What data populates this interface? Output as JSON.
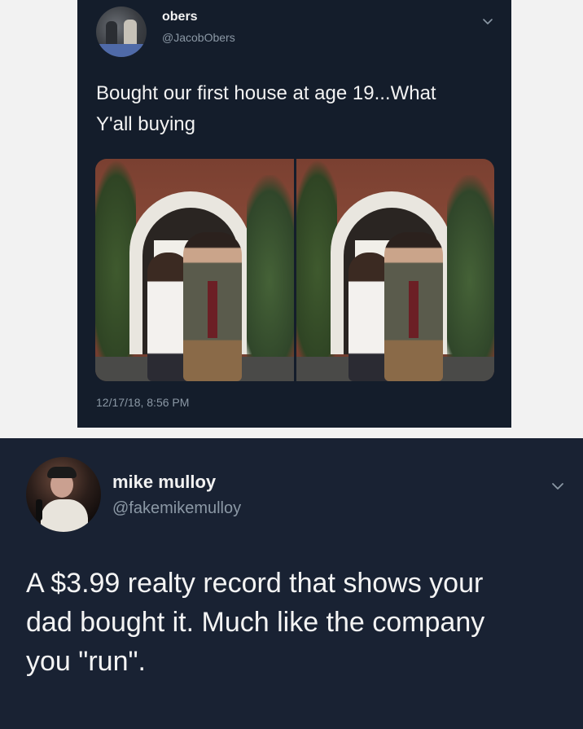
{
  "tweet_top": {
    "name": "obers",
    "handle": "@JacobObers",
    "text_line1": "Bought our first house at age 19...What",
    "text_line2": "Y'all buying",
    "date": "12/17/18, 8:56 PM",
    "chevron_icon": "chevron-down-icon"
  },
  "tweet_reply": {
    "name": "mike mulloy",
    "handle": "@fakemikemulloy",
    "text_line1": "A $3.99 realty record that shows your",
    "text_line2": "dad bought it. Much like the company",
    "text_line3": "you \"run\".",
    "chevron_icon": "chevron-down-icon"
  },
  "colors": {
    "card_background_top": "#141d2b",
    "card_background_reply": "#192233",
    "secondary_text": "#8b98a5",
    "page_background": "#f2f2f2"
  }
}
